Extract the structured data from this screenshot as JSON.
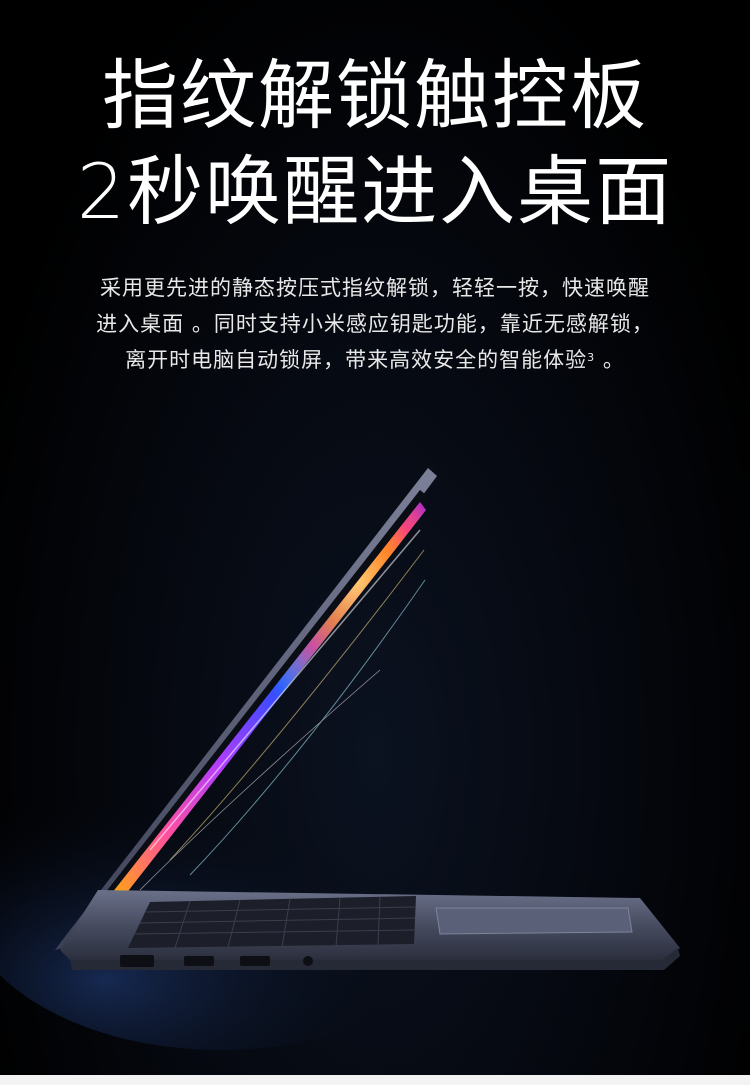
{
  "headline": {
    "line1": "指纹解锁触控板",
    "line2": "2秒唤醒进入桌面"
  },
  "description": {
    "line1": "采用更先进的静态按压式指纹解锁，轻轻一按，快速唤醒",
    "line2": "进入桌面 。同时支持小米感应钥匙功能，靠近无感解锁，",
    "line3_main": "离开时电脑自动锁屏，带来高效安全的智能体验",
    "line3_footnote": "3",
    "line3_end": " 。"
  },
  "colors": {
    "background": "#000000",
    "text": "#ffffff",
    "laptop_body": "#4a5066",
    "screen_accent": "#b23cff"
  },
  "image": {
    "subject": "laptop-product-photo"
  }
}
